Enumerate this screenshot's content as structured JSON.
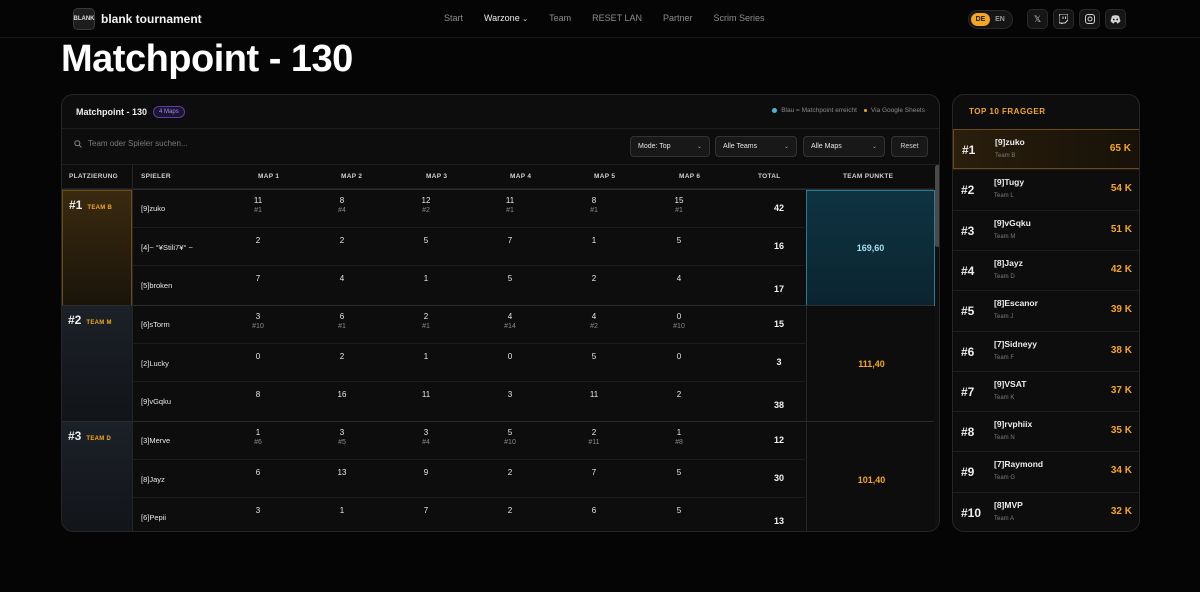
{
  "nav": {
    "logo_mark": "BLANK",
    "brand": "blank tournament",
    "links": [
      "Start",
      "Warzone",
      "Team",
      "RESET LAN",
      "Partner",
      "Scrim Series"
    ],
    "lang_de": "DE",
    "lang_en": "EN",
    "social": [
      "x-icon",
      "twitch-icon",
      "instagram-icon",
      "discord-icon"
    ]
  },
  "page": {
    "title": "Matchpoint - 130"
  },
  "panel": {
    "title": "Matchpoint - 130",
    "maps_badge": "4 Maps",
    "legend_blue": "Blau = Matchpoint erreicht",
    "legend_sheets": "Via Google Sheets",
    "search_placeholder": "Team oder Spieler suchen...",
    "mode": "Mode: Top",
    "teams": "Alle Teams",
    "maps": "Alle Maps",
    "reset": "Reset"
  },
  "table": {
    "headers": [
      "PLATZIERUNG",
      "SPIELER",
      "MAP 1",
      "MAP 2",
      "MAP 3",
      "MAP 4",
      "MAP 5",
      "MAP 6",
      "TOTAL",
      "TEAM PUNKTE"
    ],
    "groups": [
      {
        "rank": "#1",
        "team": "TEAM B",
        "team_points": "169,60",
        "highlight": true,
        "players": [
          {
            "name": "[9]zuko",
            "maps": [
              [
                "11",
                "#1"
              ],
              [
                "8",
                "#4"
              ],
              [
                "12",
                "#2"
              ],
              [
                "11",
                "#1"
              ],
              [
                "8",
                "#1"
              ],
              [
                "15",
                "#1"
              ]
            ],
            "total": "42"
          },
          {
            "name": "[4]~ °¥Stili7¥° ~",
            "maps": [
              [
                "2",
                ""
              ],
              [
                "2",
                ""
              ],
              [
                "5",
                ""
              ],
              [
                "7",
                ""
              ],
              [
                "1",
                ""
              ],
              [
                "5",
                ""
              ]
            ],
            "total": "16"
          },
          {
            "name": "[5]broken",
            "maps": [
              [
                "7",
                ""
              ],
              [
                "4",
                ""
              ],
              [
                "1",
                ""
              ],
              [
                "5",
                ""
              ],
              [
                "2",
                ""
              ],
              [
                "4",
                ""
              ]
            ],
            "total": "17"
          }
        ]
      },
      {
        "rank": "#2",
        "team": "TEAM M",
        "team_points": "111,40",
        "highlight": false,
        "players": [
          {
            "name": "[6]sTorm",
            "maps": [
              [
                "3",
                "#10"
              ],
              [
                "6",
                "#1"
              ],
              [
                "2",
                "#1"
              ],
              [
                "4",
                "#14"
              ],
              [
                "4",
                "#2"
              ],
              [
                "0",
                "#10"
              ]
            ],
            "total": "15"
          },
          {
            "name": "[2]Lucky",
            "maps": [
              [
                "0",
                ""
              ],
              [
                "2",
                ""
              ],
              [
                "1",
                ""
              ],
              [
                "0",
                ""
              ],
              [
                "5",
                ""
              ],
              [
                "0",
                ""
              ]
            ],
            "total": "3"
          },
          {
            "name": "[9]vGqku",
            "maps": [
              [
                "8",
                ""
              ],
              [
                "16",
                ""
              ],
              [
                "11",
                ""
              ],
              [
                "3",
                ""
              ],
              [
                "11",
                ""
              ],
              [
                "2",
                ""
              ]
            ],
            "total": "38"
          }
        ]
      },
      {
        "rank": "#3",
        "team": "TEAM D",
        "team_points": "101,40",
        "highlight": false,
        "players": [
          {
            "name": "[3]Merve",
            "maps": [
              [
                "1",
                "#6"
              ],
              [
                "3",
                "#5"
              ],
              [
                "3",
                "#4"
              ],
              [
                "5",
                "#10"
              ],
              [
                "2",
                "#11"
              ],
              [
                "1",
                "#8"
              ]
            ],
            "total": "12"
          },
          {
            "name": "[8]Jayz",
            "maps": [
              [
                "6",
                ""
              ],
              [
                "13",
                ""
              ],
              [
                "9",
                ""
              ],
              [
                "2",
                ""
              ],
              [
                "7",
                ""
              ],
              [
                "5",
                ""
              ]
            ],
            "total": "30"
          },
          {
            "name": "[6]Pepii",
            "maps": [
              [
                "3",
                ""
              ],
              [
                "1",
                ""
              ],
              [
                "7",
                ""
              ],
              [
                "2",
                ""
              ],
              [
                "6",
                ""
              ],
              [
                "5",
                ""
              ]
            ],
            "total": "13"
          }
        ]
      }
    ]
  },
  "fragger": {
    "title": "TOP 10 FRAGGER",
    "rows": [
      {
        "rank": "#1",
        "name": "[9]zuko",
        "team": "Team B",
        "pts": "65 K"
      },
      {
        "rank": "#2",
        "name": "[9]Tugy",
        "team": "Team L",
        "pts": "54 K"
      },
      {
        "rank": "#3",
        "name": "[9]vGqku",
        "team": "Team M",
        "pts": "51 K"
      },
      {
        "rank": "#4",
        "name": "[8]Jayz",
        "team": "Team D",
        "pts": "42 K"
      },
      {
        "rank": "#5",
        "name": "[8]Escanor",
        "team": "Team J",
        "pts": "39 K"
      },
      {
        "rank": "#6",
        "name": "[7]Sidneyy",
        "team": "Team F",
        "pts": "38 K"
      },
      {
        "rank": "#7",
        "name": "[9]VSAT",
        "team": "Team K",
        "pts": "37 K"
      },
      {
        "rank": "#8",
        "name": "[9]rvphiix",
        "team": "Team N",
        "pts": "35 K"
      },
      {
        "rank": "#9",
        "name": "[7]Raymond",
        "team": "Team G",
        "pts": "34 K"
      },
      {
        "rank": "#10",
        "name": "[8]MVP",
        "team": "Team A",
        "pts": "32 K"
      }
    ]
  },
  "colors": {
    "accent": "#f5a623",
    "matchpoint_blue": "#4fb3d9",
    "badge_purple": "#a58ce8"
  }
}
